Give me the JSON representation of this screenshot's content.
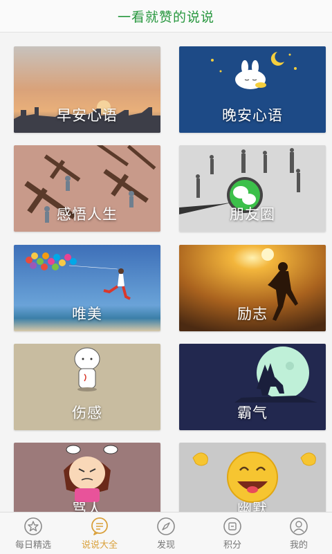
{
  "header": {
    "title": "一看就赞的说说"
  },
  "cards": [
    {
      "label": "早安心语"
    },
    {
      "label": "晚安心语"
    },
    {
      "label": "感悟人生"
    },
    {
      "label": "朋友圈"
    },
    {
      "label": "唯美"
    },
    {
      "label": "励志"
    },
    {
      "label": "伤感"
    },
    {
      "label": "霸气"
    },
    {
      "label": "骂人"
    },
    {
      "label": "幽默"
    }
  ],
  "tabbar": {
    "active_index": 1,
    "accent_color": "#d9a03a",
    "items": [
      {
        "label": "每日精选",
        "icon": "star-icon"
      },
      {
        "label": "说说大全",
        "icon": "chat-bubble-icon"
      },
      {
        "label": "发现",
        "icon": "compass-icon"
      },
      {
        "label": "积分",
        "icon": "points-icon"
      },
      {
        "label": "我的",
        "icon": "person-icon"
      }
    ]
  }
}
